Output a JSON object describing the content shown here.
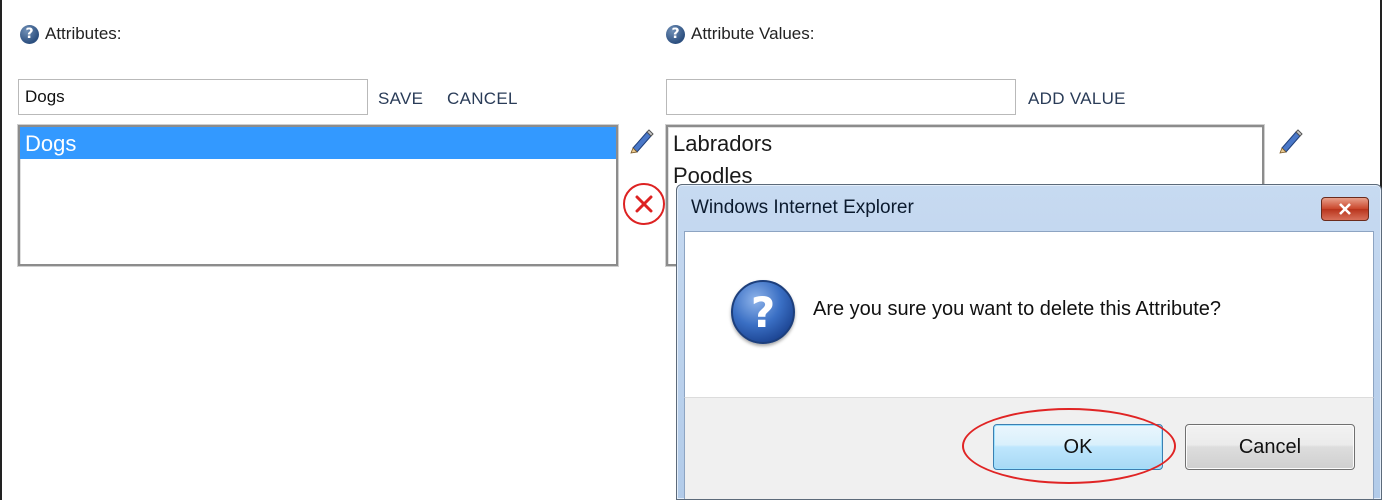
{
  "attributes": {
    "label": "Attributes:",
    "input_value": "Dogs",
    "save_label": "SAVE",
    "cancel_label": "CANCEL",
    "items": [
      "Dogs"
    ]
  },
  "attribute_values": {
    "label": "Attribute Values:",
    "input_value": "",
    "add_label": "ADD VALUE",
    "items": [
      "Labradors",
      "Poodles"
    ]
  },
  "dialog": {
    "title": "Windows Internet Explorer",
    "message": "Are you sure you want to delete this Attribute?",
    "ok_label": "OK",
    "cancel_label": "Cancel"
  },
  "icons": {
    "help": "help-circle-icon",
    "edit": "pencil-icon",
    "delete": "delete-x-icon",
    "question": "question-icon",
    "close": "close-icon"
  },
  "colors": {
    "selection": "#3399ff",
    "highlight_ring": "#e02424",
    "delete_red": "#dd2222"
  }
}
